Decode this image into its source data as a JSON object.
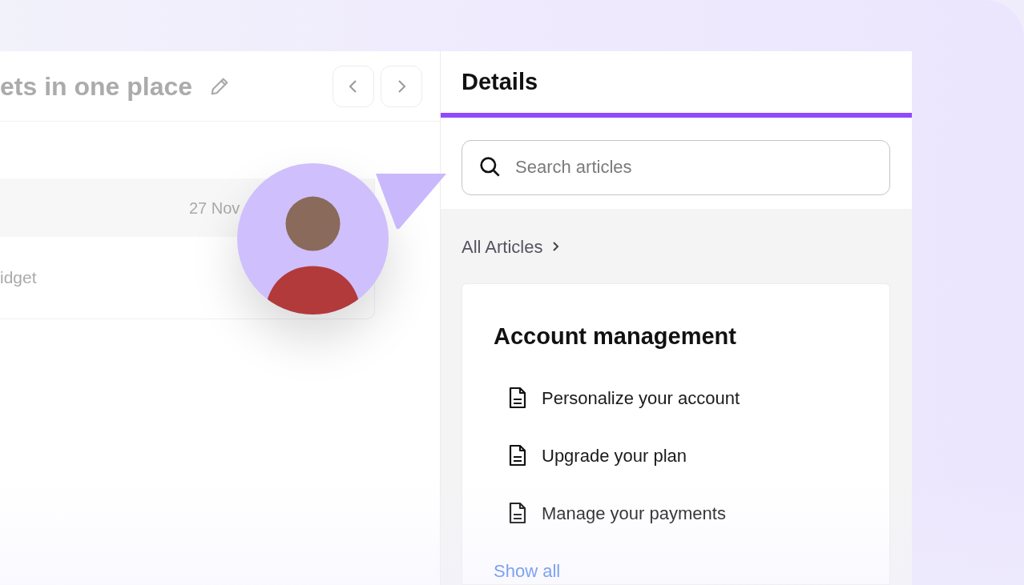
{
  "left_panel": {
    "title": "ets in one place",
    "rows": [
      {
        "date": "27 Nov"
      },
      {
        "name": "idget"
      }
    ]
  },
  "pointer": {
    "color": "#c9b8fb"
  },
  "details": {
    "title": "Details",
    "search": {
      "placeholder": "Search articles"
    },
    "breadcrumb": "All Articles",
    "section": {
      "title": "Account management",
      "articles": [
        {
          "title": "Personalize your account"
        },
        {
          "title": "Upgrade your plan"
        },
        {
          "title": "Manage your payments"
        }
      ],
      "show_all": "Show all"
    }
  }
}
